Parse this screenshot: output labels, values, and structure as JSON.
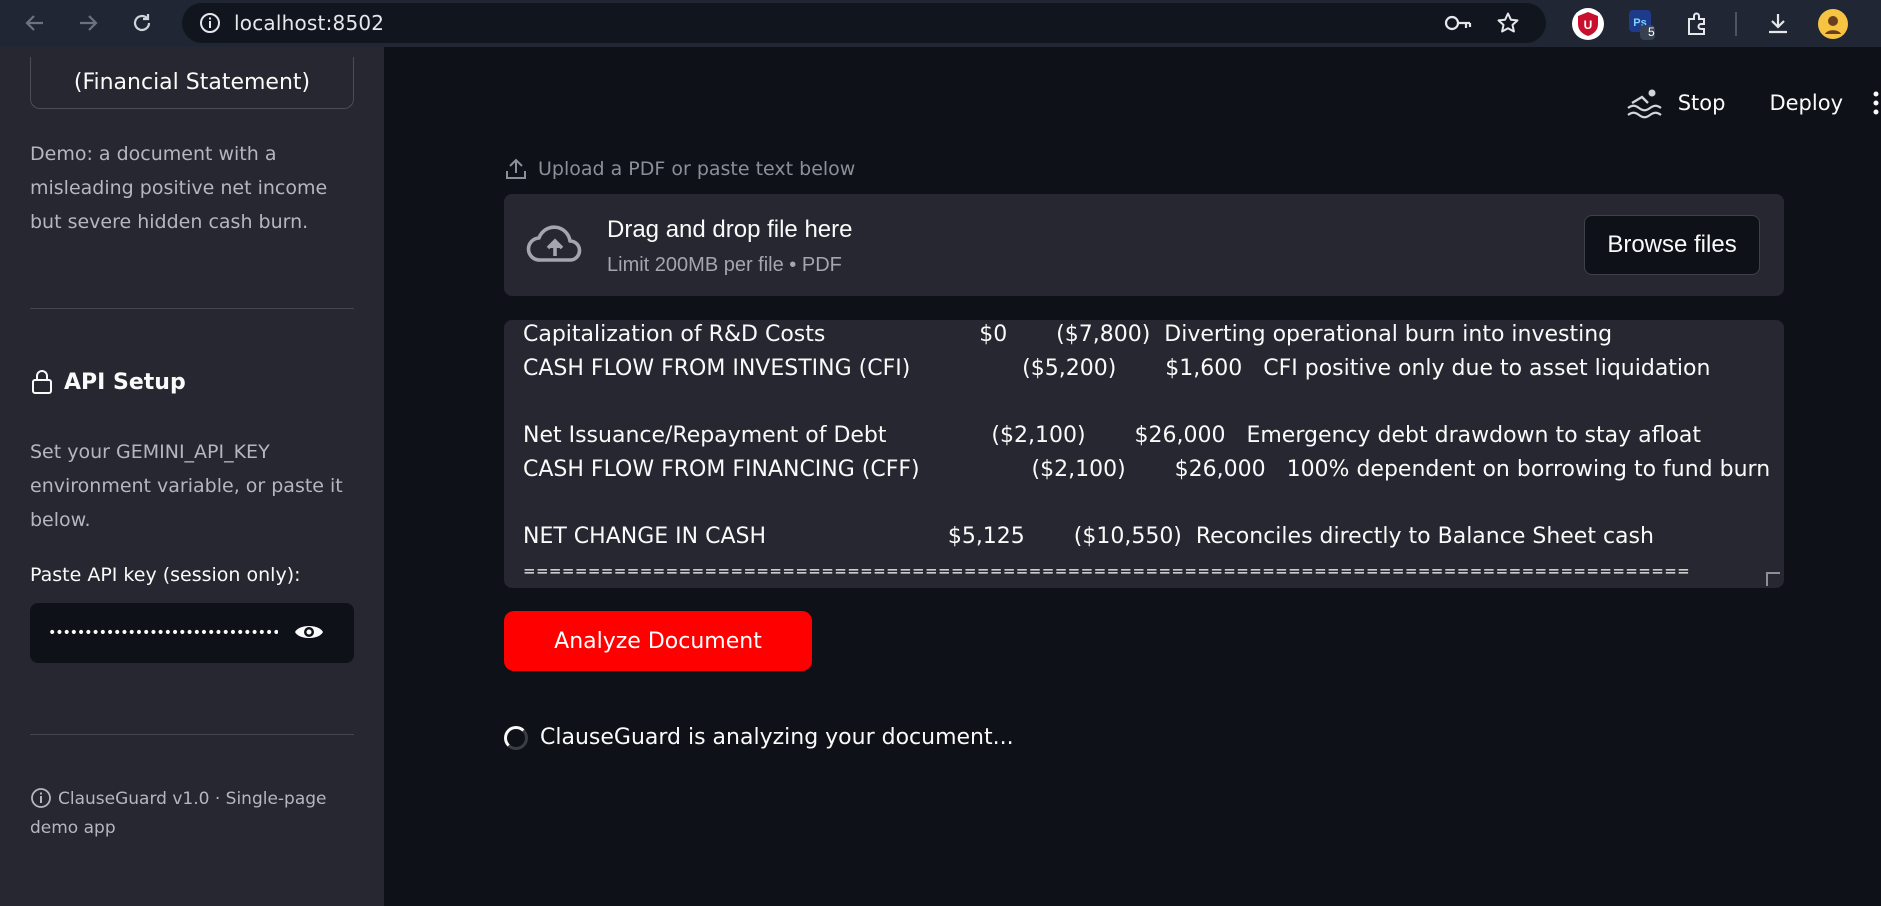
{
  "browser": {
    "url": "localhost:8502",
    "extension_badge": "5",
    "ext_ublock_letter": "U"
  },
  "sidebar": {
    "statement_button": "(Financial Statement)",
    "demo_text": "Demo: a document with a misleading positive net income but severe hidden cash burn.",
    "api_title": "API Setup",
    "api_desc": "Set your GEMINI_API_KEY environment variable, or paste it below.",
    "key_label": "Paste API key (session only):",
    "key_value": "••••••••••••••••••••••••••••••••",
    "footer": "ClauseGuard v1.0 · Single-page demo app"
  },
  "topbar": {
    "stop_label": "Stop",
    "deploy_label": "Deploy"
  },
  "upload": {
    "label": "Upload a PDF or paste text below",
    "dz_title": "Drag and drop file here",
    "dz_sub": "Limit 200MB per file • PDF",
    "browse_label": "Browse files"
  },
  "text_lines": [
    "Capitalization of R&D Costs                      $0       ($7,800)  Diverting operational burn into investing",
    "CASH FLOW FROM INVESTING (CFI)                ($5,200)       $1,600   CFI positive only due to asset liquidation",
    "",
    "Net Issuance/Repayment of Debt               ($2,100)       $26,000   Emergency debt drawdown to stay afloat",
    "CASH FLOW FROM FINANCING (CFF)                ($2,100)       $26,000   100% dependent on borrowing to fund burn",
    "",
    "NET CHANGE IN CASH                          $5,125       ($10,550)  Reconciles directly to Balance Sheet cash",
    "=========================================================================================="
  ],
  "analyze_label": "Analyze Document",
  "status_text": "ClauseGuard is analyzing your document..."
}
